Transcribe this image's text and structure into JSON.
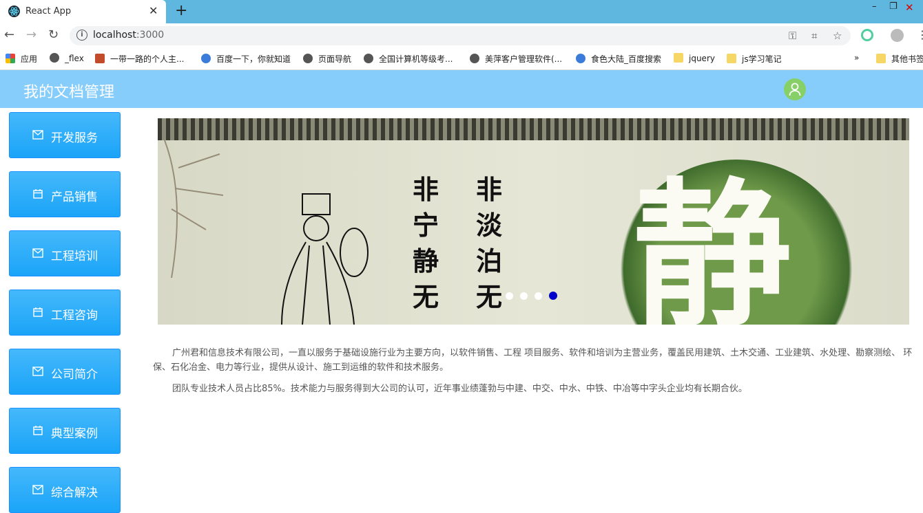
{
  "browser": {
    "tab_title": "React App",
    "tab_close": "✕",
    "new_tab": "+",
    "window_controls": [
      "–",
      "❐",
      "✕"
    ],
    "url_host": "localhost",
    "url_port": ":3000",
    "bookmarks": [
      {
        "label": "应用",
        "icon": "apps-grid-icon"
      },
      {
        "label": "_flex",
        "icon": "globe-icon"
      },
      {
        "label": "一带一路的个人主...",
        "icon": "image-icon"
      },
      {
        "label": "百度一下，你就知道",
        "icon": "baidu-paw-icon"
      },
      {
        "label": "页面导航",
        "icon": "globe-icon"
      },
      {
        "label": "全国计算机等级考...",
        "icon": "globe-icon"
      },
      {
        "label": "美萍客户管理软件(...",
        "icon": "globe-icon"
      },
      {
        "label": "食色大陆_百度搜索",
        "icon": "baidu-paw-icon"
      },
      {
        "label": "jquery",
        "icon": "folder-icon"
      },
      {
        "label": "js学习笔记",
        "icon": "folder-icon"
      },
      {
        "label": "其他书签",
        "icon": "folder-icon"
      }
    ],
    "overflow": "»"
  },
  "header": {
    "title": "我的文档管理",
    "avatar_color": "#87d068",
    "background": "#87cdfb"
  },
  "sidebar": {
    "items": [
      {
        "label": "开发服务",
        "icon": "mail-icon"
      },
      {
        "label": "产品销售",
        "icon": "calendar-icon"
      },
      {
        "label": "工程培训",
        "icon": "mail-icon"
      },
      {
        "label": "工程咨询",
        "icon": "calendar-icon"
      },
      {
        "label": "公司简介",
        "icon": "mail-icon"
      },
      {
        "label": "典型案例",
        "icon": "calendar-icon"
      },
      {
        "label": "综合解决",
        "icon": "mail-icon"
      }
    ]
  },
  "banner": {
    "poem_col1": "非宁静无",
    "poem_col2": "非淡泊无",
    "big_char": "静",
    "slide_count": 4,
    "active_slide": 4
  },
  "content": {
    "para1": "广州君和信息技术有限公司，一直以服务于基础设施行业为主要方向，以软件销售、工程 项目服务、软件和培训为主营业务，覆盖民用建筑、土木交通、工业建筑、水处理、勘察测绘、 环保、石化冶金、电力等行业，提供从设计、施工到运维的软件和技术服务。",
    "para2": "团队专业技术人员占比85%。技术能力与服务得到大公司的认可，近年事业绩蓬勃与中建、中交、中水、中铁、中冶等中字头企业均有长期合伙。"
  }
}
